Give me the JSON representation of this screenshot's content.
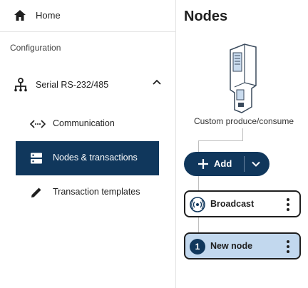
{
  "sidebar": {
    "home_label": "Home",
    "section_label": "Configuration",
    "serial_label": "Serial RS-232/485",
    "items": [
      {
        "label": "Communication",
        "icon": "code-arrows-icon"
      },
      {
        "label": "Nodes & transactions",
        "icon": "storage-icon"
      },
      {
        "label": "Transaction templates",
        "icon": "pencil-icon"
      }
    ],
    "active_item": "Nodes & transactions"
  },
  "main": {
    "title": "Nodes",
    "device_label": "Custom produce/consume",
    "add_label": "Add",
    "nodes": [
      {
        "label": "Broadcast",
        "icon": "broadcast-icon"
      },
      {
        "label": "New node",
        "number": "1"
      }
    ],
    "selected_node": "New node"
  },
  "colors": {
    "accent": "#10375c",
    "selected_node_bg": "#c2d8ee"
  }
}
